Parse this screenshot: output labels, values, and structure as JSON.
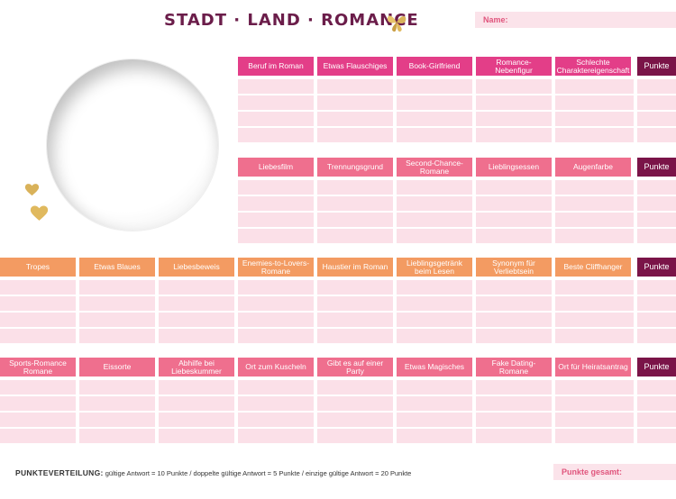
{
  "header": {
    "title": "STADT · LAND · ROMANCE",
    "name_label": "Name:"
  },
  "colors": {
    "title": "#6b1d4a",
    "magenta": "#e33e88",
    "rose": "#ef6f8e",
    "orange": "#f39b62",
    "points": "#7a1448",
    "row_fill": "#fbe0e8",
    "gold": "#d9b25a"
  },
  "icons": {
    "butterfly": "butterfly-icon",
    "heart": "heart-icon"
  },
  "sections": [
    {
      "color": "#e33e88",
      "columns": [
        "Beruf im Roman",
        "Etwas Flauschiges",
        "Book-Girlfriend",
        "Romance-Nebenfigur",
        "Schlechte Charaktereigenschaft"
      ],
      "points_label": "Punkte"
    },
    {
      "color": "#ef6f8e",
      "columns": [
        "Liebesfilm",
        "Trennungsgrund",
        "Second-Chance-Romane",
        "Lieblingsessen",
        "Augenfarbe"
      ],
      "points_label": "Punkte"
    },
    {
      "color": "#f39b62",
      "columns": [
        "Tropes",
        "Etwas Blaues",
        "Liebesbeweis",
        "Enemies-to-Lovers-Romane",
        "Haustier im Roman",
        "Lieblingsgetränk beim Lesen",
        "Synonym für Verliebtsein",
        "Beste Cliffhanger"
      ],
      "points_label": "Punkte"
    },
    {
      "color": "#ef6f8e",
      "columns": [
        "Sports-Romance Romane",
        "Eissorte",
        "Abhilfe bei Liebeskummer",
        "Ort zum Kuscheln",
        "Gibt es auf einer Party",
        "Etwas Magisches",
        "Fake Dating-Romane",
        "Ort für Heiratsantrag"
      ],
      "points_label": "Punkte"
    }
  ],
  "footer": {
    "label": "PUNKTEVERTEILUNG:",
    "text": " gültige Antwort = 10 Punkte / doppelte gültige Antwort = 5 Punkte / einzige gültige Antwort = 20 Punkte",
    "total_label": "Punkte gesamt:"
  }
}
